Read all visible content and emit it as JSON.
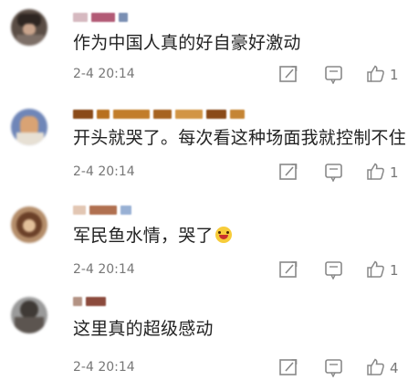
{
  "comments": [
    {
      "text": "作为中国人真的好自豪好激动",
      "time": "2-4 20:14",
      "like_count": "1"
    },
    {
      "text": "开头就哭了。每次看这种场面我就控制不住",
      "time": "2-4 20:14",
      "like_count": "1"
    },
    {
      "text": "军民鱼水情，哭了",
      "time": "2-4 20:14",
      "like_count": "1"
    },
    {
      "text": "这里真的超级感动",
      "time": "2-4 20:14",
      "like_count": "4"
    }
  ],
  "icons": {
    "repost": "repost-icon",
    "comment": "comment-icon",
    "like": "like-icon",
    "emoji": "crying-emoji-icon"
  },
  "colors": {
    "text": "#222222",
    "meta": "#777777",
    "icon": "#888888"
  }
}
